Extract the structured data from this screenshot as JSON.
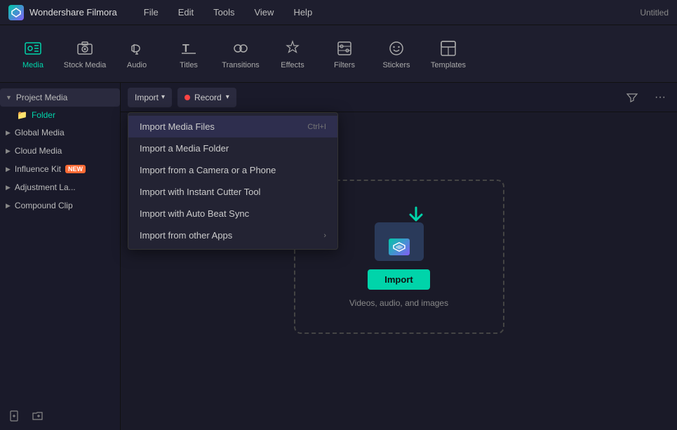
{
  "titlebar": {
    "app_name": "Wondershare Filmora",
    "window_title": "Untitled",
    "menu": [
      "File",
      "Edit",
      "Tools",
      "View",
      "Help"
    ]
  },
  "toolbar": {
    "items": [
      {
        "id": "media",
        "label": "Media",
        "active": true
      },
      {
        "id": "stock-media",
        "label": "Stock Media"
      },
      {
        "id": "audio",
        "label": "Audio"
      },
      {
        "id": "titles",
        "label": "Titles"
      },
      {
        "id": "transitions",
        "label": "Transitions"
      },
      {
        "id": "effects",
        "label": "Effects"
      },
      {
        "id": "filters",
        "label": "Filters"
      },
      {
        "id": "stickers",
        "label": "Stickers"
      },
      {
        "id": "templates",
        "label": "Templates"
      }
    ]
  },
  "sidebar": {
    "items": [
      {
        "id": "project-media",
        "label": "Project Media",
        "expanded": true
      },
      {
        "id": "folder",
        "label": "Folder"
      },
      {
        "id": "global-media",
        "label": "Global Media"
      },
      {
        "id": "cloud-media",
        "label": "Cloud Media"
      },
      {
        "id": "influence-kit",
        "label": "Influence Kit",
        "badge": "NEW"
      },
      {
        "id": "adjustment-la",
        "label": "Adjustment La..."
      },
      {
        "id": "compound-clip",
        "label": "Compound Clip"
      }
    ],
    "bottom_buttons": [
      "add-folder",
      "add-file",
      "collapse"
    ]
  },
  "panel": {
    "import_button": "Import",
    "import_dropdown_arrow": "▾",
    "record_button": "Record",
    "record_dropdown_arrow": "▾"
  },
  "import_menu": {
    "items": [
      {
        "label": "Import Media Files",
        "shortcut": "Ctrl+I"
      },
      {
        "label": "Import a Media Folder",
        "shortcut": ""
      },
      {
        "label": "Import from a Camera or a Phone",
        "shortcut": ""
      },
      {
        "label": "Import with Instant Cutter Tool",
        "shortcut": ""
      },
      {
        "label": "Import with Auto Beat Sync",
        "shortcut": ""
      },
      {
        "label": "Import from other Apps",
        "shortcut": "",
        "has_submenu": true
      }
    ]
  },
  "drop_zone": {
    "import_button": "Import",
    "description": "Videos, audio, and images"
  }
}
